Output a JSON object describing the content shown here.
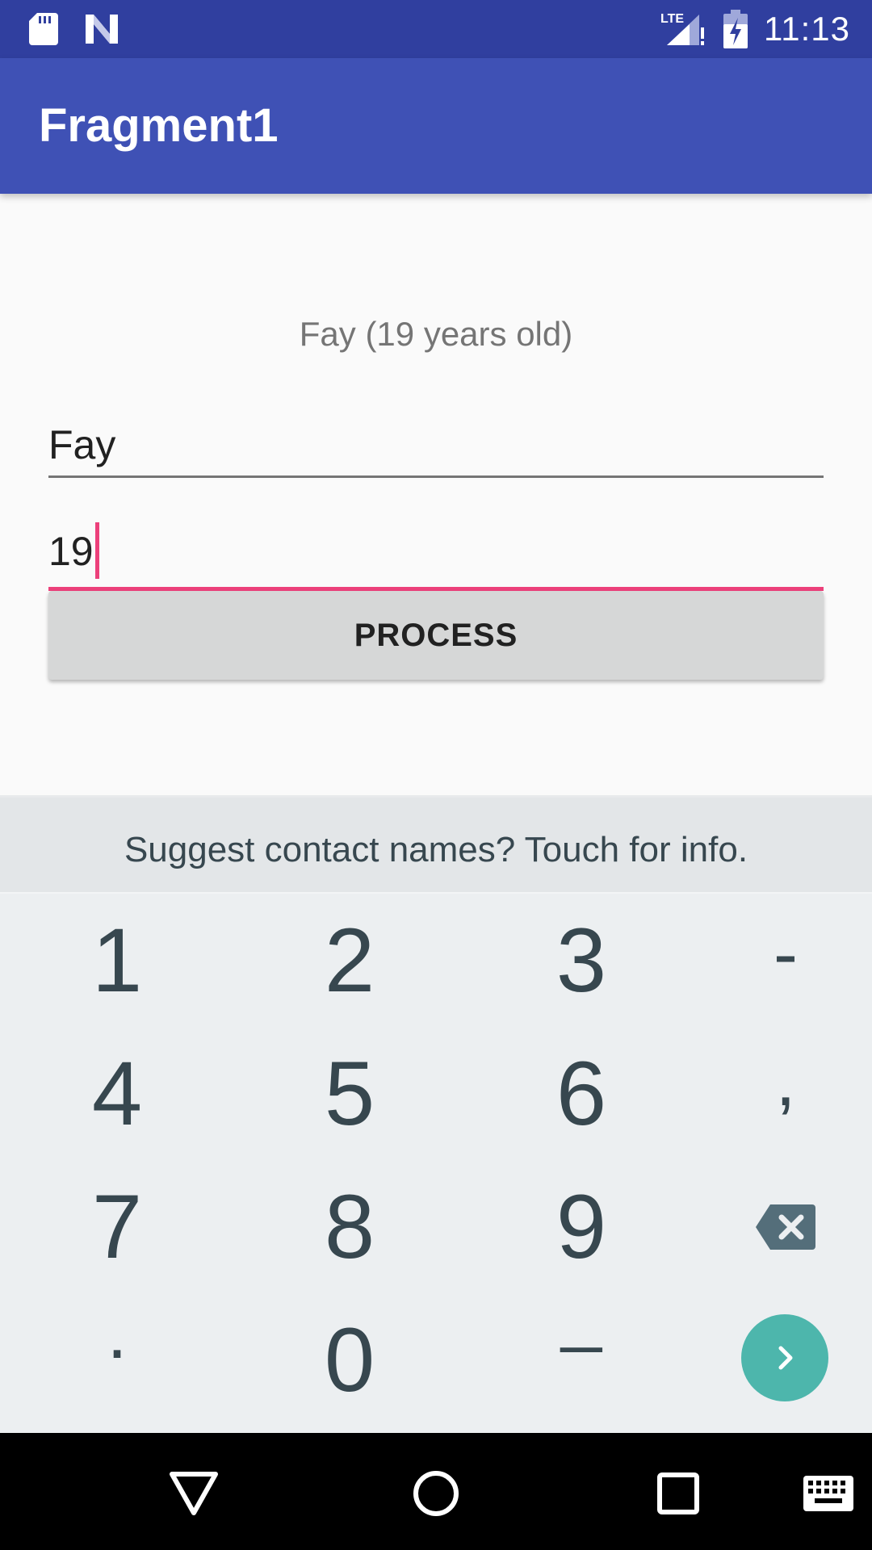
{
  "status_bar": {
    "time": "11:13",
    "network": "LTE",
    "icons": [
      "sd-card-icon",
      "n-logo-icon",
      "lte-signal-icon",
      "battery-charging-icon"
    ]
  },
  "app_bar": {
    "title": "Fragment1"
  },
  "form": {
    "summary": "Fay (19 years old)",
    "name_value": "Fay",
    "age_value": "19",
    "process_label": "PROCESS"
  },
  "keyboard": {
    "suggestion": "Suggest contact names? Touch for info.",
    "keys": {
      "k1": "1",
      "k2": "2",
      "k3": "3",
      "dash": "-",
      "k4": "4",
      "k5": "5",
      "k6": "6",
      "comma": ",",
      "k7": "7",
      "k8": "8",
      "k9": "9",
      "period": ".",
      "k0": "0",
      "space": "_"
    },
    "icons": [
      "backspace-icon",
      "next-icon"
    ]
  },
  "nav_bar": {
    "icons": [
      "back-icon",
      "home-icon",
      "recents-icon",
      "keyboard-switch-icon"
    ]
  },
  "colors": {
    "status_bar": "#303f9f",
    "app_bar": "#3f51b5",
    "accent": "#ec407a",
    "enter_key": "#4db6ac",
    "button": "#d6d7d7"
  }
}
